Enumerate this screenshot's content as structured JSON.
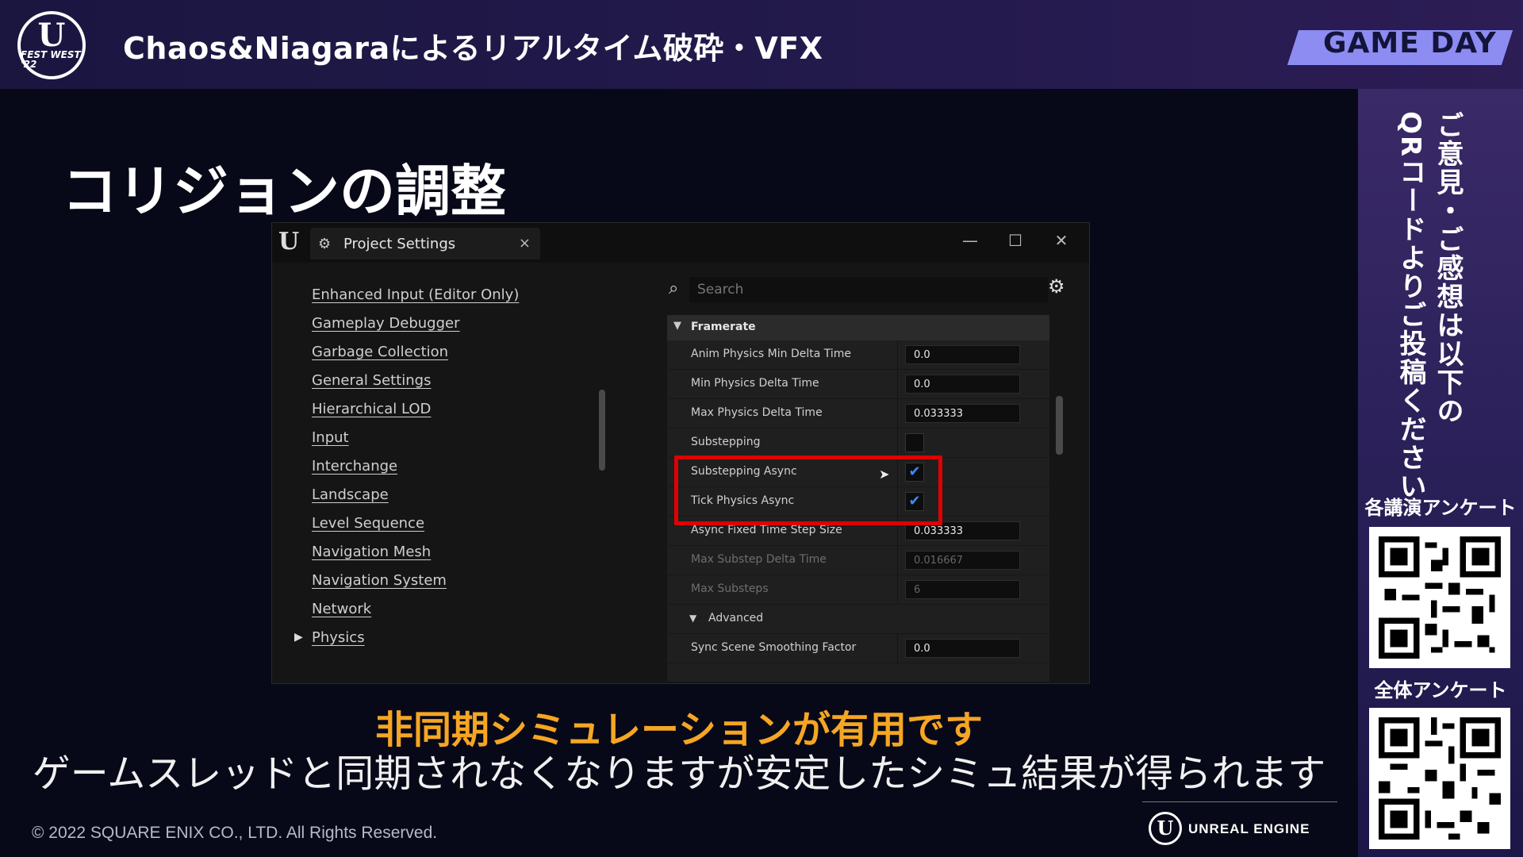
{
  "header": {
    "logo_text_main": "U",
    "logo_text_sub": "FEST WEST '22",
    "title": "Chaos&Niagaraによるリアルタイム破砕・VFX",
    "badge": "GAME DAY"
  },
  "slide": {
    "title": "コリジョンの調整",
    "caption_highlight": "非同期シミュレーションが有用です",
    "caption_body": "ゲームスレッドと同期されなくなりますが安定したシミュ結果が得られます",
    "copyright": "© 2022 SQUARE ENIX CO., LTD. All Rights Reserved.",
    "engine_logo_text": "UNREAL ENGINE"
  },
  "window": {
    "tab_title": "Project Settings",
    "tab_close": "×",
    "controls": {
      "minimize": "—",
      "maximize": "☐",
      "close": "✕"
    },
    "search": {
      "placeholder": "Search"
    },
    "nav_items": [
      "Enhanced Input (Editor Only)",
      "Gameplay Debugger",
      "Garbage Collection",
      "General Settings",
      "Hierarchical LOD",
      "Input",
      "Interchange",
      "Landscape",
      "Level Sequence",
      "Navigation Mesh",
      "Navigation System",
      "Network",
      "Physics"
    ],
    "category": "Framerate",
    "rows": [
      {
        "label": "Anim Physics Min Delta Time",
        "value": "0.0"
      },
      {
        "label": "Min Physics Delta Time",
        "value": "0.0"
      },
      {
        "label": "Max Physics Delta Time",
        "value": "0.033333"
      },
      {
        "label": "Substepping",
        "checked": false
      },
      {
        "label": "Substepping Async",
        "checked": true
      },
      {
        "label": "Tick Physics Async",
        "checked": true
      },
      {
        "label": "Async Fixed Time Step Size",
        "value": "0.033333"
      },
      {
        "label": "Max Substep Delta Time",
        "value": "0.016667",
        "disabled": true
      },
      {
        "label": "Max Substeps",
        "value": "6",
        "disabled": true
      },
      {
        "label": "Advanced",
        "subheader": true
      },
      {
        "label": "Sync Scene Smoothing Factor",
        "value": "0.0"
      }
    ],
    "check_glyph": "✔"
  },
  "sidebar": {
    "vertical_line1": "ご意見・ご感想は以下の",
    "vertical_line2": "QRコードよりご投稿ください",
    "qr1_label": "各講演アンケート",
    "qr2_label": "全体アンケート"
  },
  "colors": {
    "highlight_caption": "#f5a623",
    "badge_bg": "#8c8cf2",
    "redbox": "#e00000",
    "checkbox": "#3d8bff"
  }
}
